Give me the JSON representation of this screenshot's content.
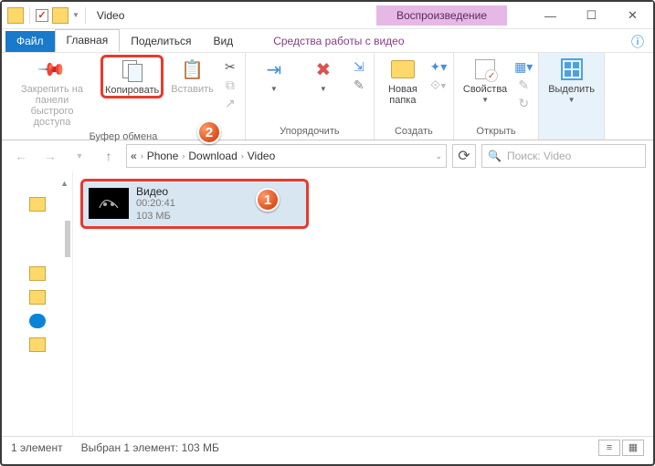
{
  "window": {
    "title": "Video"
  },
  "context_tab": {
    "label": "Воспроизведение",
    "group": "Средства работы с видео"
  },
  "tabs": {
    "file": "Файл",
    "home": "Главная",
    "share": "Поделиться",
    "view": "Вид"
  },
  "ribbon": {
    "pin": {
      "label": "Закрепить на панели\nбыстрого доступа"
    },
    "copy": {
      "label": "Копировать"
    },
    "paste": {
      "label": "Вставить"
    },
    "clipboard_group": "Буфер обмена",
    "organize_group": "Упорядочить",
    "newfolder": {
      "label": "Новая\nпапка"
    },
    "new_group": "Создать",
    "properties": {
      "label": "Свойства"
    },
    "open_group": "Открыть",
    "select": {
      "label": "Выделить"
    }
  },
  "breadcrumb": {
    "root": "«",
    "p1": "Phone",
    "p2": "Download",
    "p3": "Video"
  },
  "search": {
    "placeholder": "Поиск: Video"
  },
  "file": {
    "name": "Видео",
    "duration": "00:20:41",
    "size": "103 МБ"
  },
  "status": {
    "count": "1 элемент",
    "selection": "Выбран 1 элемент: 103 МБ"
  },
  "badges": {
    "one": "1",
    "two": "2"
  }
}
